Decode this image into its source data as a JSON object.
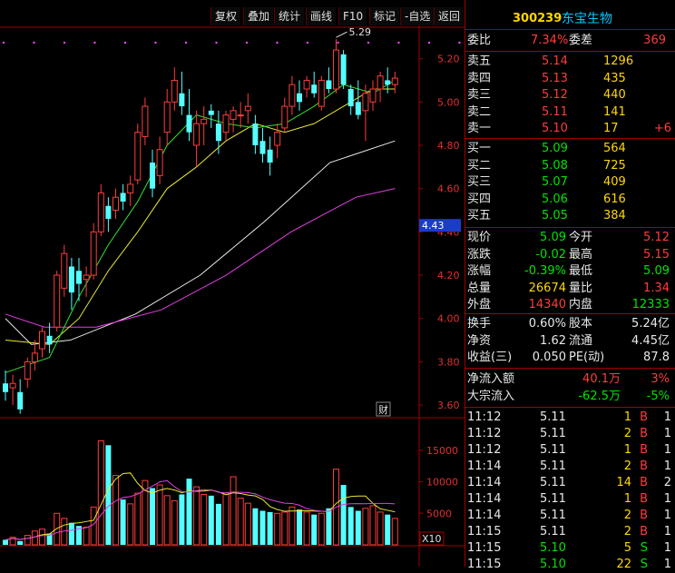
{
  "toolbar": {
    "buttons": [
      "复权",
      "叠加",
      "统计",
      "画线",
      "F10",
      "标记",
      "-自选",
      "返回"
    ]
  },
  "chart": {
    "price_axis": [
      "5.20",
      "5.00",
      "4.80",
      "4.60",
      "4.40",
      "4.20",
      "4.00",
      "3.80",
      "3.60"
    ],
    "price_marker": "4.43",
    "high_label": "5.29",
    "finance_badge": "财",
    "volume_axis": [
      "15000",
      "10000",
      "5000"
    ],
    "volume_unit": "X10"
  },
  "chart_data": {
    "type": "candlestick",
    "ylim": [
      3.55,
      5.32
    ],
    "volume_ylim": [
      0,
      18000
    ],
    "candles": [
      {
        "o": 3.7,
        "h": 3.76,
        "l": 3.62,
        "c": 3.66
      },
      {
        "o": 3.68,
        "h": 3.74,
        "l": 3.6,
        "c": 3.7
      },
      {
        "o": 3.66,
        "h": 3.72,
        "l": 3.56,
        "c": 3.58
      },
      {
        "o": 3.72,
        "h": 3.82,
        "l": 3.68,
        "c": 3.8
      },
      {
        "o": 3.8,
        "h": 3.9,
        "l": 3.76,
        "c": 3.84
      },
      {
        "o": 3.86,
        "h": 3.96,
        "l": 3.82,
        "c": 3.94
      },
      {
        "o": 3.92,
        "h": 3.98,
        "l": 3.84,
        "c": 3.88
      },
      {
        "o": 3.96,
        "h": 4.22,
        "l": 3.94,
        "c": 4.2
      },
      {
        "o": 4.14,
        "h": 4.34,
        "l": 4.1,
        "c": 4.3
      },
      {
        "o": 4.24,
        "h": 4.28,
        "l": 4.04,
        "c": 4.12
      },
      {
        "o": 4.22,
        "h": 4.28,
        "l": 4.08,
        "c": 4.16
      },
      {
        "o": 4.18,
        "h": 4.24,
        "l": 4.1,
        "c": 4.2
      },
      {
        "o": 4.2,
        "h": 4.44,
        "l": 4.18,
        "c": 4.4
      },
      {
        "o": 4.4,
        "h": 4.62,
        "l": 4.38,
        "c": 4.58
      },
      {
        "o": 4.52,
        "h": 4.56,
        "l": 4.4,
        "c": 4.46
      },
      {
        "o": 4.5,
        "h": 4.6,
        "l": 4.46,
        "c": 4.56
      },
      {
        "o": 4.58,
        "h": 4.62,
        "l": 4.5,
        "c": 4.54
      },
      {
        "o": 4.58,
        "h": 4.66,
        "l": 4.52,
        "c": 4.62
      },
      {
        "o": 4.64,
        "h": 4.9,
        "l": 4.62,
        "c": 4.86
      },
      {
        "o": 4.84,
        "h": 5.02,
        "l": 4.8,
        "c": 4.98
      },
      {
        "o": 4.72,
        "h": 4.78,
        "l": 4.56,
        "c": 4.6
      },
      {
        "o": 4.66,
        "h": 4.84,
        "l": 4.62,
        "c": 4.78
      },
      {
        "o": 4.86,
        "h": 5.06,
        "l": 4.8,
        "c": 5.0
      },
      {
        "o": 5.0,
        "h": 5.16,
        "l": 4.96,
        "c": 5.1
      },
      {
        "o": 5.04,
        "h": 5.14,
        "l": 4.94,
        "c": 4.98
      },
      {
        "o": 4.94,
        "h": 5.06,
        "l": 4.82,
        "c": 4.86
      },
      {
        "o": 4.8,
        "h": 4.96,
        "l": 4.7,
        "c": 4.9
      },
      {
        "o": 4.9,
        "h": 4.98,
        "l": 4.8,
        "c": 4.92
      },
      {
        "o": 4.96,
        "h": 4.99,
        "l": 4.88,
        "c": 4.94
      },
      {
        "o": 4.9,
        "h": 4.96,
        "l": 4.76,
        "c": 4.82
      },
      {
        "o": 4.86,
        "h": 4.96,
        "l": 4.82,
        "c": 4.94
      },
      {
        "o": 4.92,
        "h": 4.98,
        "l": 4.86,
        "c": 4.96
      },
      {
        "o": 4.94,
        "h": 5.0,
        "l": 4.88,
        "c": 4.94
      },
      {
        "o": 4.96,
        "h": 5.04,
        "l": 4.9,
        "c": 4.98
      },
      {
        "o": 4.9,
        "h": 4.94,
        "l": 4.76,
        "c": 4.8
      },
      {
        "o": 4.82,
        "h": 4.88,
        "l": 4.72,
        "c": 4.76
      },
      {
        "o": 4.78,
        "h": 4.84,
        "l": 4.66,
        "c": 4.72
      },
      {
        "o": 4.8,
        "h": 4.9,
        "l": 4.74,
        "c": 4.86
      },
      {
        "o": 4.88,
        "h": 5.02,
        "l": 4.86,
        "c": 4.98
      },
      {
        "o": 4.98,
        "h": 5.12,
        "l": 4.94,
        "c": 5.08
      },
      {
        "o": 5.04,
        "h": 5.1,
        "l": 4.96,
        "c": 5.0
      },
      {
        "o": 5.06,
        "h": 5.12,
        "l": 5.02,
        "c": 5.1
      },
      {
        "o": 5.08,
        "h": 5.14,
        "l": 5.02,
        "c": 5.04
      },
      {
        "o": 4.98,
        "h": 5.12,
        "l": 4.96,
        "c": 5.1
      },
      {
        "o": 5.1,
        "h": 5.16,
        "l": 5.04,
        "c": 5.06
      },
      {
        "o": 5.06,
        "h": 5.29,
        "l": 5.04,
        "c": 5.24
      },
      {
        "o": 5.22,
        "h": 5.24,
        "l": 5.06,
        "c": 5.08
      },
      {
        "o": 5.06,
        "h": 5.08,
        "l": 4.94,
        "c": 4.98
      },
      {
        "o": 5.0,
        "h": 5.1,
        "l": 4.92,
        "c": 4.94
      },
      {
        "o": 4.96,
        "h": 5.08,
        "l": 4.82,
        "c": 5.04
      },
      {
        "o": 5.0,
        "h": 5.1,
        "l": 4.96,
        "c": 5.06
      },
      {
        "o": 5.06,
        "h": 5.14,
        "l": 5.0,
        "c": 5.12
      },
      {
        "o": 5.1,
        "h": 5.16,
        "l": 5.04,
        "c": 5.08
      },
      {
        "o": 5.08,
        "h": 5.14,
        "l": 5.04,
        "c": 5.11
      }
    ],
    "volume": [
      800,
      1200,
      600,
      1500,
      2200,
      2500,
      1800,
      5000,
      4200,
      3500,
      3000,
      2800,
      6000,
      16500,
      15800,
      11000,
      7200,
      6500,
      8200,
      10200,
      9000,
      9500,
      7800,
      7000,
      8000,
      10500,
      9200,
      8000,
      7800,
      6500,
      8200,
      10800,
      7400,
      6600,
      5800,
      5400,
      5200,
      5000,
      5200,
      6000,
      5600,
      5200,
      4800,
      5000,
      5800,
      12000,
      9500,
      6000,
      5400,
      5800,
      6200,
      5200,
      4800,
      4200
    ],
    "series": [],
    "ma": {
      "white": [
        [
          0,
          4.0
        ],
        [
          4,
          3.88
        ],
        [
          10,
          3.9
        ],
        [
          20,
          4.02
        ],
        [
          30,
          4.2
        ],
        [
          40,
          4.45
        ],
        [
          50,
          4.72
        ],
        [
          60,
          4.82
        ]
      ],
      "magenta": [
        [
          0,
          4.02
        ],
        [
          6,
          3.96
        ],
        [
          14,
          3.96
        ],
        [
          24,
          4.04
        ],
        [
          34,
          4.2
        ],
        [
          44,
          4.4
        ],
        [
          54,
          4.56
        ],
        [
          60,
          4.6
        ]
      ],
      "yellow": [
        [
          0,
          3.9
        ],
        [
          6,
          3.88
        ],
        [
          10,
          4.0
        ],
        [
          14,
          4.22
        ],
        [
          18,
          4.4
        ],
        [
          22,
          4.6
        ],
        [
          26,
          4.7
        ],
        [
          30,
          4.82
        ],
        [
          34,
          4.9
        ],
        [
          38,
          4.86
        ],
        [
          42,
          4.9
        ],
        [
          46,
          4.98
        ],
        [
          50,
          5.06
        ],
        [
          53,
          5.06
        ]
      ],
      "green": [
        [
          0,
          3.75
        ],
        [
          6,
          3.82
        ],
        [
          10,
          4.1
        ],
        [
          14,
          4.34
        ],
        [
          18,
          4.54
        ],
        [
          22,
          4.8
        ],
        [
          26,
          4.94
        ],
        [
          30,
          4.9
        ],
        [
          34,
          4.88
        ],
        [
          38,
          4.9
        ],
        [
          42,
          4.98
        ],
        [
          46,
          5.08
        ],
        [
          50,
          5.04
        ],
        [
          53,
          5.1
        ]
      ]
    }
  },
  "quote": {
    "code": "300239",
    "name": "东宝生物",
    "weibi_label": "委比",
    "weibi_value": "7.34%",
    "weicha_label": "委差",
    "weicha_value": "369",
    "asks": [
      {
        "label": "卖五",
        "price": "5.14",
        "vol": "1296",
        "chg": ""
      },
      {
        "label": "卖四",
        "price": "5.13",
        "vol": "435",
        "chg": ""
      },
      {
        "label": "卖三",
        "price": "5.12",
        "vol": "440",
        "chg": ""
      },
      {
        "label": "卖二",
        "price": "5.11",
        "vol": "141",
        "chg": ""
      },
      {
        "label": "卖一",
        "price": "5.10",
        "vol": "17",
        "chg": "+6"
      }
    ],
    "bids": [
      {
        "label": "买一",
        "price": "5.09",
        "vol": "564"
      },
      {
        "label": "买二",
        "price": "5.08",
        "vol": "725"
      },
      {
        "label": "买三",
        "price": "5.07",
        "vol": "409"
      },
      {
        "label": "买四",
        "price": "5.06",
        "vol": "616"
      },
      {
        "label": "买五",
        "price": "5.05",
        "vol": "384"
      }
    ],
    "stats": [
      {
        "l1": "现价",
        "v1": "5.09",
        "c1": "green",
        "l2": "今开",
        "v2": "5.12",
        "c2": "red"
      },
      {
        "l1": "涨跌",
        "v1": "-0.02",
        "c1": "green",
        "l2": "最高",
        "v2": "5.15",
        "c2": "red"
      },
      {
        "l1": "涨幅",
        "v1": "-0.39%",
        "c1": "green",
        "l2": "最低",
        "v2": "5.09",
        "c2": "green"
      },
      {
        "l1": "总量",
        "v1": "26674",
        "c1": "yellow",
        "l2": "量比",
        "v2": "1.34",
        "c2": "red"
      },
      {
        "l1": "外盘",
        "v1": "14340",
        "c1": "red",
        "l2": "内盘",
        "v2": "12333",
        "c2": "green"
      }
    ],
    "fund": [
      {
        "l1": "换手",
        "v1": "0.60%",
        "l2": "股本",
        "v2": "5.24亿"
      },
      {
        "l1": "净资",
        "v1": "1.62",
        "l2": "流通",
        "v2": "4.45亿"
      },
      {
        "l1": "收益(三)",
        "v1": "0.050",
        "l2": "PE(动)",
        "v2": "87.8"
      }
    ],
    "flow": [
      {
        "label": "净流入额",
        "value": "40.1万",
        "pct": "3%",
        "color": "red"
      },
      {
        "label": "大宗流入",
        "value": "-62.5万",
        "pct": "-5%",
        "color": "green"
      }
    ],
    "ticks": [
      {
        "time": "11:12",
        "price": "5.11",
        "vol": "1",
        "bs": "B",
        "n": "1",
        "pc": "white",
        "bc": "red"
      },
      {
        "time": "11:12",
        "price": "5.11",
        "vol": "2",
        "bs": "B",
        "n": "1",
        "pc": "white",
        "bc": "red"
      },
      {
        "time": "11:12",
        "price": "5.11",
        "vol": "1",
        "bs": "B",
        "n": "1",
        "pc": "white",
        "bc": "red"
      },
      {
        "time": "11:14",
        "price": "5.11",
        "vol": "2",
        "bs": "B",
        "n": "1",
        "pc": "white",
        "bc": "red"
      },
      {
        "time": "11:14",
        "price": "5.11",
        "vol": "14",
        "bs": "B",
        "n": "2",
        "pc": "white",
        "bc": "red"
      },
      {
        "time": "11:14",
        "price": "5.11",
        "vol": "1",
        "bs": "B",
        "n": "1",
        "pc": "white",
        "bc": "red"
      },
      {
        "time": "11:14",
        "price": "5.11",
        "vol": "2",
        "bs": "B",
        "n": "1",
        "pc": "white",
        "bc": "red"
      },
      {
        "time": "11:15",
        "price": "5.11",
        "vol": "2",
        "bs": "B",
        "n": "1",
        "pc": "white",
        "bc": "red"
      },
      {
        "time": "11:15",
        "price": "5.10",
        "vol": "5",
        "bs": "S",
        "n": "1",
        "pc": "green",
        "bc": "green"
      },
      {
        "time": "11:15",
        "price": "5.10",
        "vol": "22",
        "bs": "S",
        "n": "1",
        "pc": "green",
        "bc": "green"
      }
    ]
  },
  "colors": {
    "up": "#ff3c3c",
    "down": "#54ffff",
    "grid": "#a00000",
    "bg": "#000000"
  }
}
